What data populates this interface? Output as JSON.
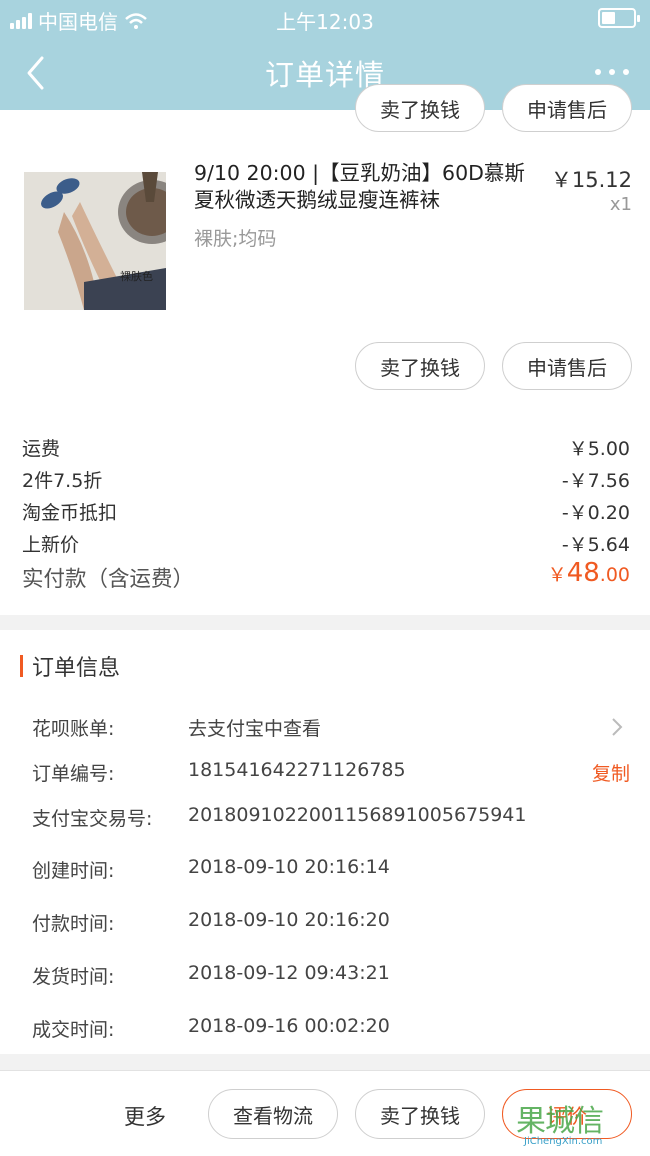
{
  "status_bar": {
    "carrier": "中国电信",
    "time": "上午12:03"
  },
  "nav": {
    "title": "订单详情"
  },
  "product_card": {
    "top_buttons": [
      "卖了换钱",
      "申请售后"
    ],
    "title": "9/10 20:00 |【豆乳奶油】60D慕斯夏秋微透天鹅绒显瘦连裤袜",
    "sku": "裸肤;均码",
    "price": "￥15.12",
    "quantity": "x1",
    "image_caption": "裸肤色",
    "buttons": [
      "卖了换钱",
      "申请售后"
    ]
  },
  "fees": [
    {
      "label": "运费",
      "value": "￥5.00"
    },
    {
      "label": "2件7.5折",
      "value": "-￥7.56"
    },
    {
      "label": "淘金币抵扣",
      "value": "-￥0.20"
    },
    {
      "label": "上新价",
      "value": "-￥5.64"
    }
  ],
  "total": {
    "label": "实付款（含运费）",
    "currency": "￥",
    "integer": "48",
    "decimal": ".00"
  },
  "order_info": {
    "heading": "订单信息",
    "rows": [
      {
        "label": "花呗账单:",
        "value": "去支付宝中查看"
      },
      {
        "label": "订单编号:",
        "value": "181541642271126785",
        "action": "复制"
      },
      {
        "label": "支付宝交易号:",
        "value": "2018091022001156891005675941"
      },
      {
        "label": "创建时间:",
        "value": "2018-09-10 20:16:14"
      },
      {
        "label": "付款时间:",
        "value": "2018-09-10 20:16:20"
      },
      {
        "label": "发货时间:",
        "value": "2018-09-12 09:43:21"
      },
      {
        "label": "成交时间:",
        "value": "2018-09-16 00:02:20"
      }
    ]
  },
  "bottom_bar": {
    "more": "更多",
    "buttons": [
      "查看物流",
      "卖了换钱",
      "评价"
    ]
  },
  "watermark": {
    "logo": "果城信",
    "url": "JiChengXin.com"
  },
  "colors": {
    "header": "#a8d3de",
    "accent": "#f05a22"
  }
}
